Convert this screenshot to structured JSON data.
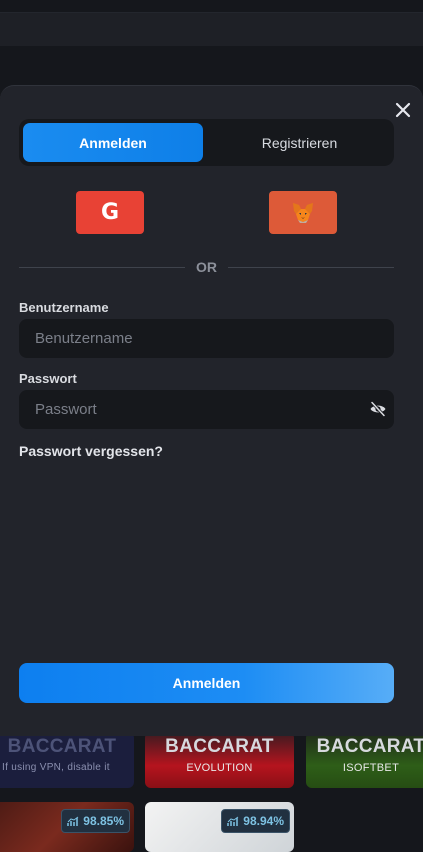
{
  "modal": {
    "tabs": {
      "login": "Anmelden",
      "register": "Registrieren"
    },
    "social": {
      "google_letter": "G",
      "google_icon": "google-icon",
      "wallet_icon": "metamask-fox-icon"
    },
    "divider_text": "OR",
    "username": {
      "label": "Benutzername",
      "placeholder": "Benutzername",
      "value": ""
    },
    "password": {
      "label": "Passwort",
      "placeholder": "Passwort",
      "value": ""
    },
    "forgot_password": "Passwort vergessen?",
    "submit_label": "Anmelden"
  },
  "background_tiles": [
    {
      "title": "BACCARAT",
      "subtitle": "If using VPN, disable it"
    },
    {
      "title": "BACCARAT",
      "subtitle": "EVOLUTION"
    },
    {
      "title": "BACCARAT",
      "subtitle": "ISOFTBET"
    },
    {
      "rtp": "98.85%"
    },
    {
      "rtp": "98.94%"
    }
  ],
  "colors": {
    "accent": "#1a8cf0",
    "google": "#e84235",
    "metamask": "#dd5a38",
    "modal_bg": "#22242b",
    "field_bg": "#16181c"
  }
}
